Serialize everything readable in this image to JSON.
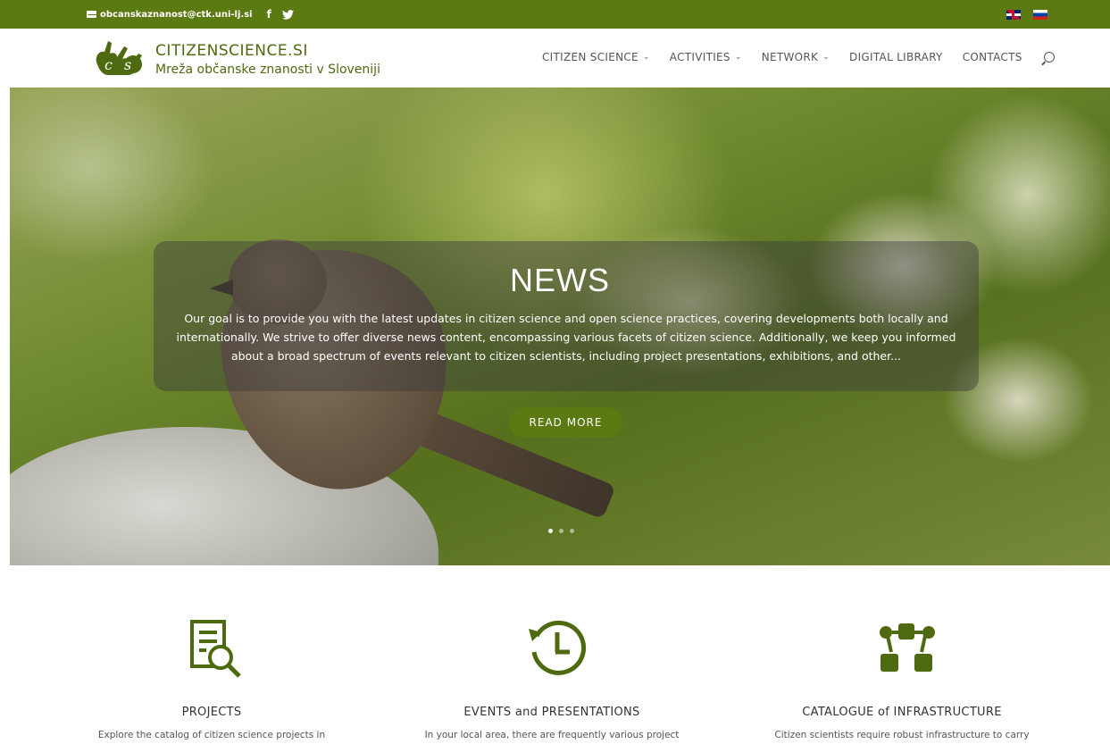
{
  "topbar": {
    "email": "obcanskaznanost@ctk.uni-lj.si",
    "facebook_glyph": "f",
    "twitter_glyph": "🐦",
    "lang_en": "en-flag-icon",
    "lang_si": "si-flag-icon",
    "color": "#5b7a12"
  },
  "header": {
    "site_title": "CITIZENSCIENCE.SI",
    "site_subtitle": "Mreža občanske znanosti v Sloveniji",
    "nav": [
      {
        "label": "CITIZEN SCIENCE",
        "has_dropdown": true
      },
      {
        "label": "ACTIVITIES",
        "has_dropdown": true
      },
      {
        "label": "NETWORK",
        "has_dropdown": true
      },
      {
        "label": "DIGITAL LIBRARY",
        "has_dropdown": false
      },
      {
        "label": "CONTACTS",
        "has_dropdown": false
      }
    ],
    "chevron": "⌄"
  },
  "hero": {
    "title": "NEWS",
    "text": "Our goal is to provide you with the latest updates in citizen science and open science practices, covering developments both locally and internationally. We strive to offer diverse news content, encompassing various facets of citizen science. Additionally, we keep you informed about a broad spectrum of events relevant to citizen scientists, including project presentations, exhibitions, and other...",
    "button": "READ MORE",
    "slides": 3,
    "active_slide": 1
  },
  "features": [
    {
      "icon": "document-search-icon",
      "title": "PROJECTS",
      "desc": "Explore the catalog of citizen science projects in"
    },
    {
      "icon": "history-clock-icon",
      "title": "EVENTS and PRESENTATIONS",
      "desc": "In your local area, there are frequently various project"
    },
    {
      "icon": "network-nodes-icon",
      "title": "CATALOGUE of INFRASTRUCTURE",
      "desc": "Citizen scientists require robust infrastructure to carry"
    }
  ]
}
